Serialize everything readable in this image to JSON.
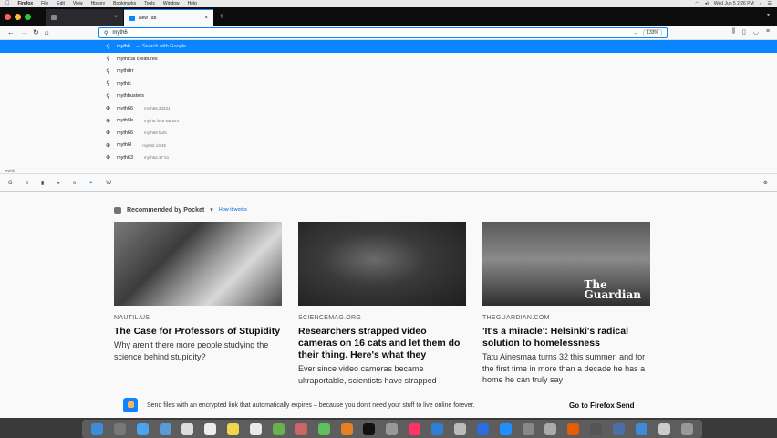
{
  "menubar": {
    "apple": "",
    "app": "Firefox",
    "items": [
      "File",
      "Edit",
      "View",
      "History",
      "Bookmarks",
      "Tools",
      "Window",
      "Help"
    ],
    "clock": "Wed Jun 5 2:26 PM"
  },
  "tabs": {
    "background_tab": "",
    "active_tab": "New Tab"
  },
  "urlbar": {
    "value": "myth6",
    "zoom": "133%"
  },
  "suggestions": [
    {
      "icon": "search-icon",
      "text": "myth6",
      "action": "— Search with Google"
    },
    {
      "icon": "search-icon",
      "text": "mythical creatures",
      "action": ""
    },
    {
      "icon": "search-icon",
      "text": "mythdrr",
      "action": ""
    },
    {
      "icon": "search-icon",
      "text": "mythic",
      "action": ""
    },
    {
      "icon": "search-icon",
      "text": "mythbusters",
      "action": ""
    },
    {
      "icon": "globe-icon",
      "text": "myth66",
      "url": "myth66.23331"
    },
    {
      "icon": "globe-icon",
      "text": "myth6b",
      "url": "myth6 fo45 wattors"
    },
    {
      "icon": "globe-icon",
      "text": "myth66",
      "url": "myth68 fa45"
    },
    {
      "icon": "globe-icon",
      "text": "myth6l",
      "url": "myth6l 13 45"
    },
    {
      "icon": "globe-icon",
      "text": "myth63",
      "url": "myth6a 37 51"
    }
  ],
  "dropdown_mini_label": "myth6",
  "pocket": {
    "heading": "Recommended by Pocket",
    "how_link": "How it works",
    "cards": [
      {
        "source": "NAUTIL.US",
        "title": "The Case for Professors of Stupidity",
        "desc": "Why aren't there more people studying the science behind stupidity?"
      },
      {
        "source": "SCIENCEMAG.ORG",
        "title": "Researchers strapped video cameras on 16 cats and let them do their thing. Here's what they",
        "desc": "Ever since video cameras became ultraportable, scientists have strapped"
      },
      {
        "source": "THEGUARDIAN.COM",
        "title": "'It's a miracle': Helsinki's radical solution to homelessness",
        "desc": "Tatu Ainesmaa turns 32 this summer, and for the first time in more than a decade he has a home he can truly say"
      }
    ],
    "guardian_logo": [
      "The",
      "Guardian"
    ]
  },
  "send": {
    "message": "Send files with an encrypted link that automatically expires – because you don't need your stuff to live online forever.",
    "cta": "Go to Firefox Send"
  },
  "colors": {
    "accent": "#0a84ff",
    "tabstrip": "#0c0c0d",
    "page_bg": "#f9f9fa"
  }
}
